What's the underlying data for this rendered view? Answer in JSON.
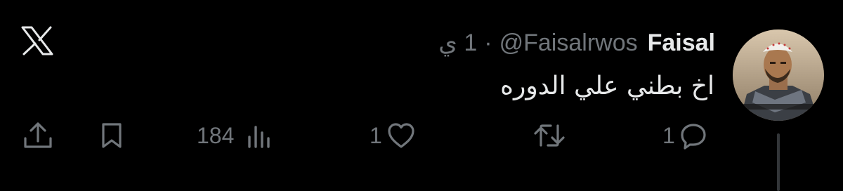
{
  "tweet": {
    "display_name": "Faisal",
    "handle": "@Faisalrwos",
    "separator": "·",
    "time": "1 ي",
    "text": "اخ بطني علي الدوره"
  },
  "actions": {
    "reply_count": "1",
    "retweet_count": "",
    "like_count": "1",
    "views_count": "184"
  },
  "icons": {
    "brand": "x-logo-icon",
    "reply": "speech-bubble-icon",
    "retweet": "retweet-arrows-icon",
    "like": "heart-icon",
    "views": "bar-chart-icon",
    "bookmark": "bookmark-icon",
    "share": "share-upload-icon"
  },
  "colors": {
    "background": "#000000",
    "primary_text": "#e7e9ea",
    "secondary_text": "#71767b",
    "thread_line": "#333639"
  }
}
